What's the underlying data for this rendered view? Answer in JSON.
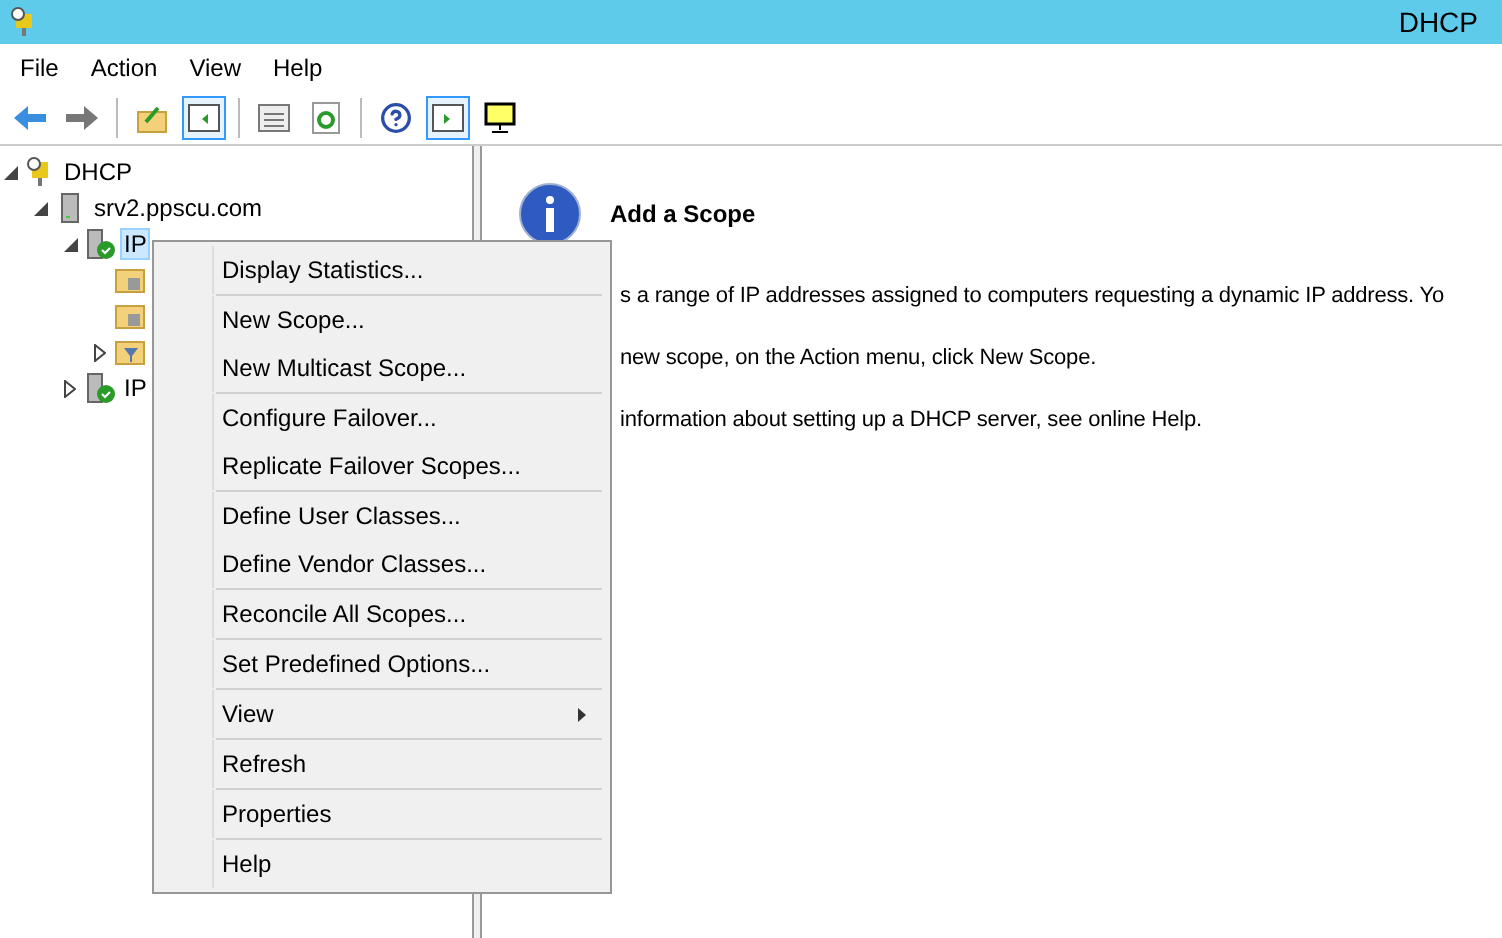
{
  "window": {
    "title": "DHCP"
  },
  "menu_bar": [
    "File",
    "Action",
    "View",
    "Help"
  ],
  "tree": [
    {
      "label": "DHCP",
      "kind": "root",
      "expanded": true,
      "children": [
        {
          "label": "srv2.ppscu.com",
          "kind": "server",
          "expanded": true,
          "children": [
            {
              "label": "IP",
              "kind": "scope",
              "expanded": true,
              "selected": true,
              "children": [
                {
                  "kind": "folder"
                },
                {
                  "kind": "folder"
                },
                {
                  "kind": "filter",
                  "has_children": true
                }
              ]
            },
            {
              "label": "IP",
              "kind": "scope",
              "expanded": false,
              "selected": false,
              "has_children": true
            }
          ]
        }
      ]
    }
  ],
  "content": {
    "heading": "Add a Scope",
    "lines": [
      "s a range of IP addresses assigned to computers requesting a dynamic IP address. Yo",
      "new scope, on the Action menu, click New Scope.",
      "information about setting up a DHCP server, see online Help."
    ]
  },
  "context_menu": [
    {
      "kind": "item",
      "label": "Display Statistics..."
    },
    {
      "kind": "separator"
    },
    {
      "kind": "item",
      "label": "New Scope..."
    },
    {
      "kind": "item",
      "label": "New Multicast Scope..."
    },
    {
      "kind": "separator"
    },
    {
      "kind": "item",
      "label": "Configure Failover..."
    },
    {
      "kind": "item",
      "label": "Replicate Failover Scopes..."
    },
    {
      "kind": "separator"
    },
    {
      "kind": "item",
      "label": "Define User Classes..."
    },
    {
      "kind": "item",
      "label": "Define Vendor Classes..."
    },
    {
      "kind": "separator"
    },
    {
      "kind": "item",
      "label": "Reconcile All Scopes..."
    },
    {
      "kind": "separator"
    },
    {
      "kind": "item",
      "label": "Set Predefined Options..."
    },
    {
      "kind": "separator"
    },
    {
      "kind": "submenu",
      "label": "View"
    },
    {
      "kind": "separator"
    },
    {
      "kind": "item",
      "label": "Refresh"
    },
    {
      "kind": "separator"
    },
    {
      "kind": "item",
      "label": "Properties"
    },
    {
      "kind": "separator"
    },
    {
      "kind": "item",
      "label": "Help"
    }
  ]
}
